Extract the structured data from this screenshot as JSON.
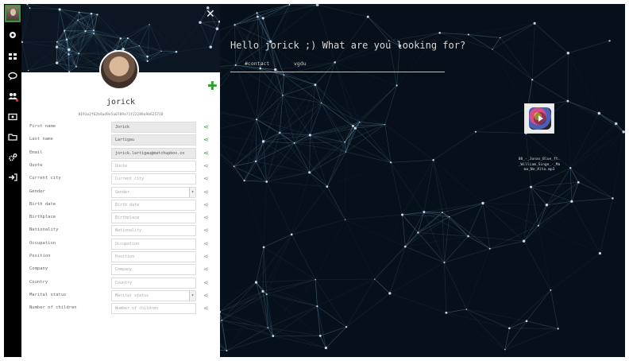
{
  "greeting": "Hello jorick ;) What are you looking for?",
  "search_tags": [
    "#contact",
    "vgdu"
  ],
  "profile": {
    "name": "jorick",
    "id_hash": "8193a2f62b9ad9e5a0789a71f22289a9b62572D"
  },
  "fields": [
    {
      "label": "First name",
      "value": "Jorick",
      "placeholder": "",
      "type": "text",
      "shared": true
    },
    {
      "label": "Last name",
      "value": "Lartigau",
      "placeholder": "",
      "type": "text",
      "shared": true
    },
    {
      "label": "Email",
      "value": "jorick.lartigau@matchupbox.co",
      "placeholder": "",
      "type": "text",
      "shared": true
    },
    {
      "label": "Quote",
      "value": "",
      "placeholder": "Quote",
      "type": "text",
      "shared": false
    },
    {
      "label": "Current city",
      "value": "",
      "placeholder": "Current city",
      "type": "text",
      "shared": false
    },
    {
      "label": "Gender",
      "value": "Gender",
      "placeholder": "",
      "type": "select",
      "shared": false
    },
    {
      "label": "Birth date",
      "value": "",
      "placeholder": "Birth date",
      "type": "text",
      "shared": false
    },
    {
      "label": "Birthplace",
      "value": "",
      "placeholder": "Birthplace",
      "type": "text",
      "shared": false
    },
    {
      "label": "Nationality",
      "value": "",
      "placeholder": "Nationality",
      "type": "text",
      "shared": false
    },
    {
      "label": "Occupation",
      "value": "",
      "placeholder": "Occupation",
      "type": "text",
      "shared": false
    },
    {
      "label": "Position",
      "value": "",
      "placeholder": "Position",
      "type": "text",
      "shared": false
    },
    {
      "label": "Company",
      "value": "",
      "placeholder": "Company",
      "type": "text",
      "shared": false
    },
    {
      "label": "Country",
      "value": "",
      "placeholder": "Country",
      "type": "text",
      "shared": false
    },
    {
      "label": "Marital status",
      "value": "Marital status",
      "placeholder": "",
      "type": "select",
      "shared": false
    },
    {
      "label": "Number of children",
      "value": "",
      "placeholder": "Number of children",
      "type": "text",
      "shared": false
    }
  ],
  "media_file": {
    "name": "08_-_Jonas_Blue_ft._William_Singe_-_Mama_Ne_Alta.mp3"
  },
  "sidebar_icons": [
    "avatar",
    "pin-icon",
    "grid-icon",
    "chat-icon",
    "users-icon",
    "card-icon",
    "folder-icon",
    "cogs-icon",
    "logout-icon"
  ],
  "colors": {
    "share_active": "#3b9a3b",
    "add_button": "#2ea02e",
    "notification": "#e53030",
    "background": "#05090f"
  }
}
